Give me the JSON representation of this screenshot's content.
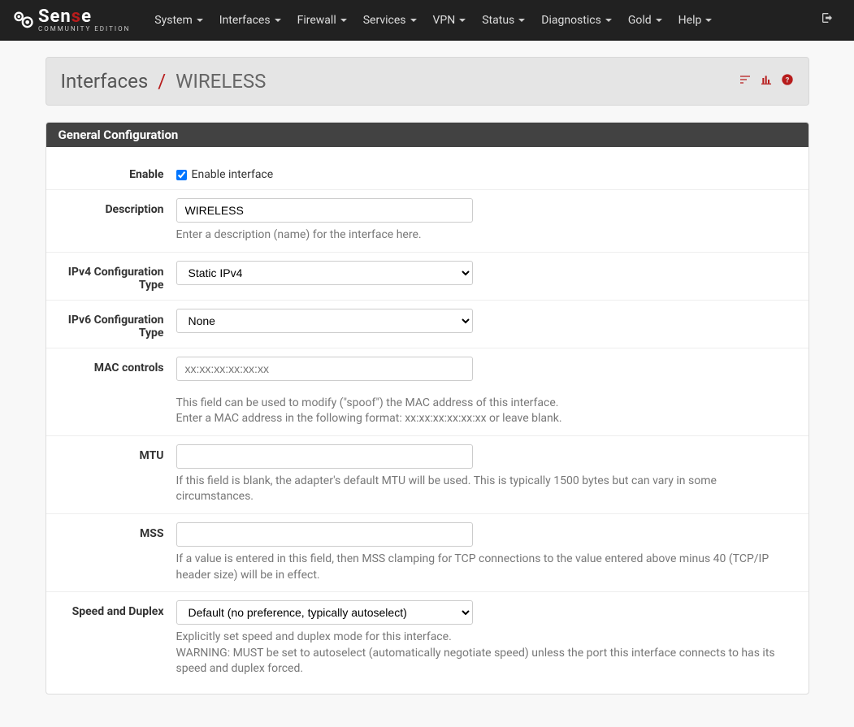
{
  "brand": {
    "main_a": "Sen",
    "main_b": "s",
    "main_c": "e",
    "sub": "COMMUNITY EDITION"
  },
  "nav": {
    "items": [
      {
        "label": "System"
      },
      {
        "label": "Interfaces"
      },
      {
        "label": "Firewall"
      },
      {
        "label": "Services"
      },
      {
        "label": "VPN"
      },
      {
        "label": "Status"
      },
      {
        "label": "Diagnostics"
      },
      {
        "label": "Gold"
      },
      {
        "label": "Help"
      }
    ]
  },
  "header": {
    "root": "Interfaces",
    "sep": "/",
    "current": "WIRELESS"
  },
  "panel": {
    "title": "General Configuration"
  },
  "form": {
    "enable": {
      "label": "Enable",
      "checkbox_label": "Enable interface",
      "checked": true
    },
    "description": {
      "label": "Description",
      "value": "WIRELESS",
      "help": "Enter a description (name) for the interface here."
    },
    "ipv4": {
      "label": "IPv4 Configuration Type",
      "value": "Static IPv4"
    },
    "ipv6": {
      "label": "IPv6 Configuration Type",
      "value": "None"
    },
    "mac": {
      "label": "MAC controls",
      "placeholder": "xx:xx:xx:xx:xx:xx",
      "help1": "This field can be used to modify (\"spoof\") the MAC address of this interface.",
      "help2": "Enter a MAC address in the following format: xx:xx:xx:xx:xx:xx or leave blank."
    },
    "mtu": {
      "label": "MTU",
      "help": "If this field is blank, the adapter's default MTU will be used. This is typically 1500 bytes but can vary in some circumstances."
    },
    "mss": {
      "label": "MSS",
      "help": "If a value is entered in this field, then MSS clamping for TCP connections to the value entered above minus 40 (TCP/IP header size) will be in effect."
    },
    "speed": {
      "label": "Speed and Duplex",
      "value": "Default (no preference, typically autoselect)",
      "help1": "Explicitly set speed and duplex mode for this interface.",
      "help2": "WARNING: MUST be set to autoselect (automatically negotiate speed) unless the port this interface connects to has its speed and duplex forced."
    }
  }
}
